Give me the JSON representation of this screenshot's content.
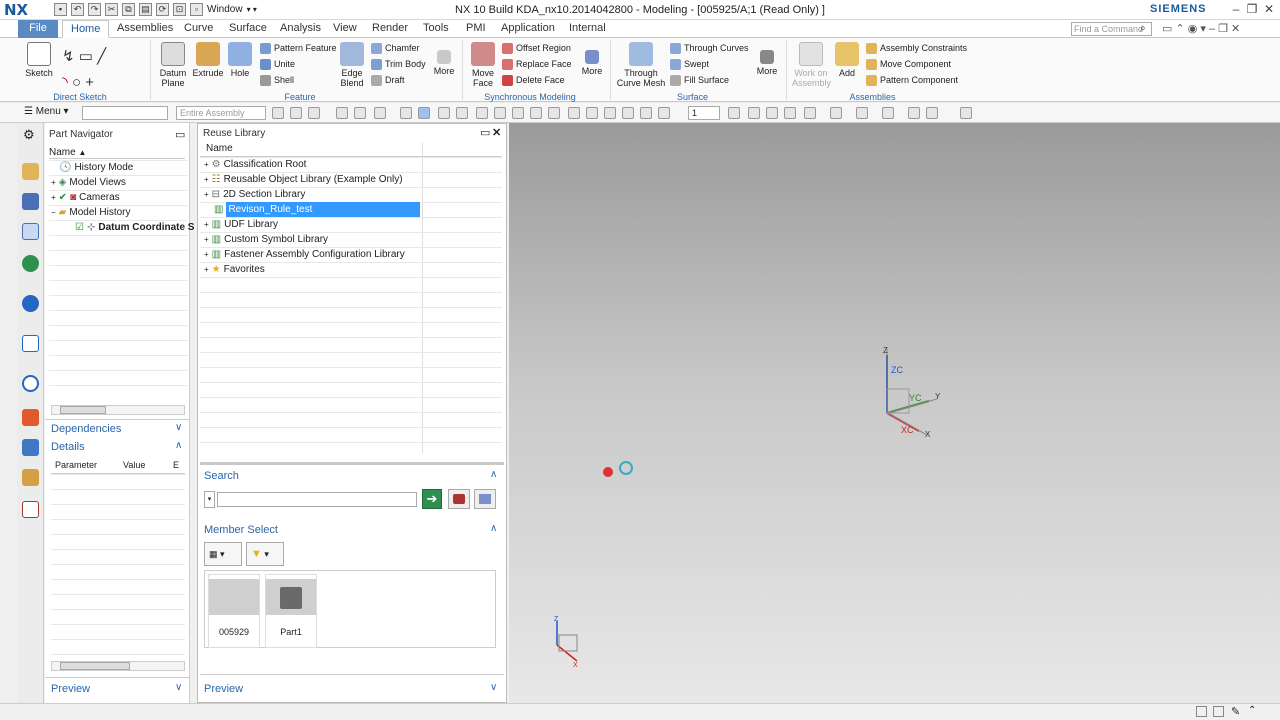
{
  "titlebar": {
    "logo": "NX",
    "window_menu": "Window",
    "title": "NX 10  Build KDA_nx10.2014042800 - Modeling - [005925/A;1 (Read Only) ]",
    "brand": "SIEMENS"
  },
  "tabs": [
    "File",
    "Home",
    "Assemblies",
    "Curve",
    "Surface",
    "Analysis",
    "View",
    "Render",
    "Tools",
    "PMI",
    "Application",
    "Internal"
  ],
  "find_command": {
    "placeholder": "Find a Command"
  },
  "ribbon": {
    "direct_sketch": {
      "sketch": "Sketch",
      "group_label": "Direct Sketch"
    },
    "feature": {
      "datum_plane": "Datum Plane",
      "extrude": "Extrude",
      "hole": "Hole",
      "pattern_feature": "Pattern Feature",
      "unite": "Unite",
      "shell": "Shell",
      "edge_blend": "Edge Blend",
      "chamfer": "Chamfer",
      "trim_body": "Trim Body",
      "draft": "Draft",
      "more": "More",
      "group_label": "Feature"
    },
    "synchronous": {
      "move_face": "Move Face",
      "offset_region": "Offset Region",
      "replace_face": "Replace Face",
      "delete_face": "Delete Face",
      "more": "More",
      "group_label": "Synchronous Modeling"
    },
    "surface": {
      "through_curve_mesh": "Through Curve Mesh",
      "through_curves": "Through Curves",
      "swept": "Swept",
      "fill_surface": "Fill Surface",
      "more": "More",
      "group_label": "Surface"
    },
    "assemblies": {
      "work_on_assembly": "Work on Assembly",
      "add": "Add",
      "assembly_constraints": "Assembly Constraints",
      "move_component": "Move Component",
      "pattern_component": "Pattern Component",
      "group_label": "Assemblies"
    }
  },
  "toolbar2": {
    "menu": "Menu",
    "filter_placeholder": "",
    "scope": "Entire Assembly",
    "layer": "1"
  },
  "part_navigator": {
    "title": "Part Navigator",
    "column": "Name",
    "items": [
      {
        "label": "History Mode",
        "icon": "clock-icon"
      },
      {
        "label": "Model Views",
        "icon": "views-icon"
      },
      {
        "label": "Cameras",
        "icon": "camera-icon"
      },
      {
        "label": "Model History",
        "icon": "folder-icon"
      },
      {
        "label": "Datum Coordinate S",
        "icon": "datum-csys-icon"
      }
    ],
    "dependencies": "Dependencies",
    "details": "Details",
    "details_columns": [
      "Parameter",
      "Value",
      "E"
    ],
    "preview": "Preview"
  },
  "reuse_library": {
    "title": "Reuse Library",
    "column": "Name",
    "items": [
      "Classification Root",
      "Reusable Object Library (Example Only)",
      "2D Section Library",
      "Revison_Rule_test",
      "UDF Library",
      "Custom Symbol Library",
      "Fastener Assembly Configuration Library",
      "Favorites"
    ],
    "selected_index": 3,
    "search_label": "Search",
    "search_value": "",
    "member_select_label": "Member Select",
    "members": [
      "005929",
      "Part1"
    ],
    "preview": "Preview"
  },
  "graphics": {
    "csys_labels": [
      "Z",
      "ZC",
      "YC",
      "Y",
      "XC",
      "X"
    ],
    "mini_labels": [
      "Z",
      "X"
    ]
  },
  "colors": {
    "accent": "#1a5aa0",
    "selection": "#3399ff",
    "file_tab": "#5b8ac2"
  }
}
